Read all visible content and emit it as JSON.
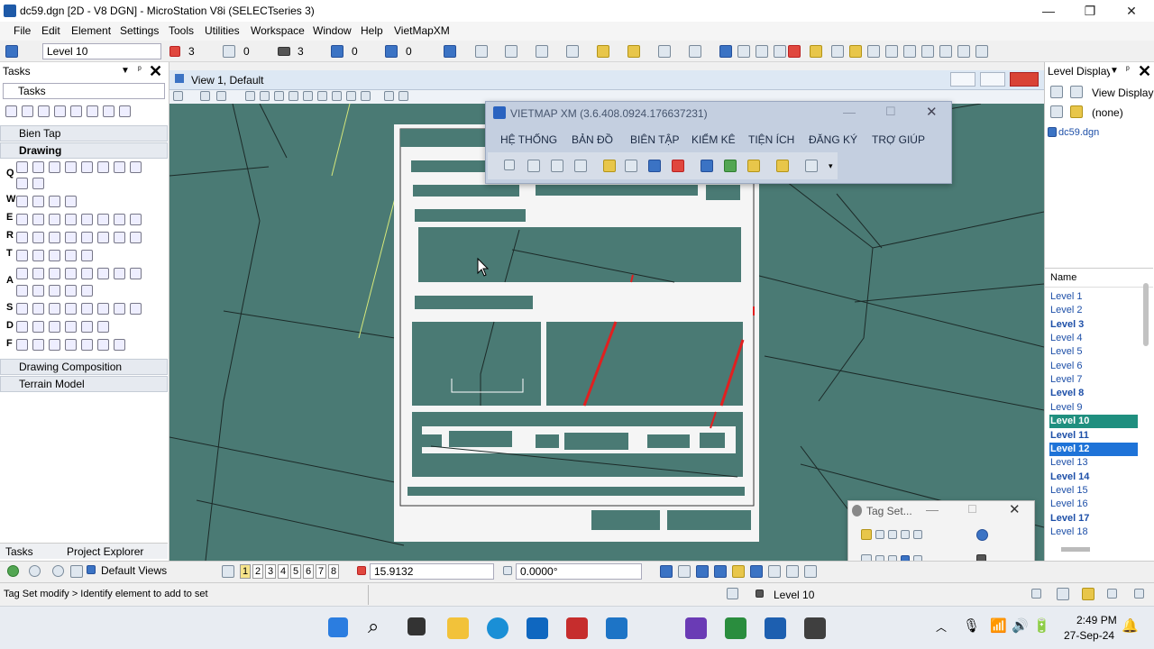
{
  "window": {
    "title": "dc59.dgn [2D - V8 DGN] - MicroStation V8i (SELECTseries 3)",
    "minimize": "—",
    "restore": "❐",
    "close": "✕"
  },
  "menu": [
    "File",
    "Edit",
    "Element",
    "Settings",
    "Tools",
    "Utilities",
    "Workspace",
    "Window",
    "Help",
    "VietMapXM"
  ],
  "toolbar": {
    "level": "Level 10",
    "color": "3",
    "linestyle": "0",
    "weight": "3",
    "val1": "0",
    "val2": "0"
  },
  "tasks": {
    "header": "Tasks",
    "combo": "Tasks",
    "sections": [
      {
        "label": "Bien Tap"
      },
      {
        "label": "Drawing"
      },
      {
        "label": "Drawing Composition"
      },
      {
        "label": "Terrain Model"
      }
    ],
    "row_letters": [
      "Q",
      "W",
      "E",
      "R",
      "T",
      "A",
      "S",
      "D",
      "F"
    ]
  },
  "bottom_tabs": [
    "Tasks",
    "Project Explorer"
  ],
  "view": {
    "title": "View 1, Default"
  },
  "vietmap": {
    "title": "VIETMAP XM (3.6.408.0924.176637231)",
    "tabs": [
      "HỆ THỐNG",
      "BẢN ĐỒ",
      "BIÊN TẬP",
      "KIỂM KÊ",
      "TIỆN ÍCH",
      "ĐĂNG KÝ",
      "TRỢ GIÚP"
    ]
  },
  "level_display": {
    "title": "Level Display",
    "view_label": "View Display",
    "filter": "(none)",
    "file": "dc59.dgn",
    "column": "Name",
    "levels": [
      {
        "name": "Level 1",
        "bold": false,
        "state": ""
      },
      {
        "name": "Level 2",
        "bold": false,
        "state": ""
      },
      {
        "name": "Level 3",
        "bold": true,
        "state": ""
      },
      {
        "name": "Level 4",
        "bold": false,
        "state": ""
      },
      {
        "name": "Level 5",
        "bold": false,
        "state": ""
      },
      {
        "name": "Level 6",
        "bold": false,
        "state": ""
      },
      {
        "name": "Level 7",
        "bold": false,
        "state": ""
      },
      {
        "name": "Level 8",
        "bold": true,
        "state": ""
      },
      {
        "name": "Level 9",
        "bold": false,
        "state": ""
      },
      {
        "name": "Level 10",
        "bold": true,
        "state": "active"
      },
      {
        "name": "Level 11",
        "bold": true,
        "state": ""
      },
      {
        "name": "Level 12",
        "bold": true,
        "state": "selected"
      },
      {
        "name": "Level 13",
        "bold": false,
        "state": ""
      },
      {
        "name": "Level 14",
        "bold": true,
        "state": ""
      },
      {
        "name": "Level 15",
        "bold": false,
        "state": ""
      },
      {
        "name": "Level 16",
        "bold": false,
        "state": ""
      },
      {
        "name": "Level 17",
        "bold": true,
        "state": ""
      },
      {
        "name": "Level 18",
        "bold": false,
        "state": ""
      }
    ]
  },
  "tagset": {
    "title": "Tag Set..."
  },
  "viewbar": {
    "default_views": "Default Views",
    "view_numbers": [
      "1",
      "2",
      "3",
      "4",
      "5",
      "6",
      "7",
      "8"
    ],
    "coord": "15.9132",
    "angle": "0.0000°"
  },
  "status": {
    "prompt": "Tag Set modify > Identify element to add to set",
    "level": "Level 10"
  },
  "taskbar": {
    "time": "2:49 PM",
    "date": "27-Sep-24"
  },
  "colors": {
    "canvas": "#4a7a74",
    "active_level": "#1f8f7f",
    "selected_level": "#1e73d8",
    "red_line": "#e02020"
  }
}
